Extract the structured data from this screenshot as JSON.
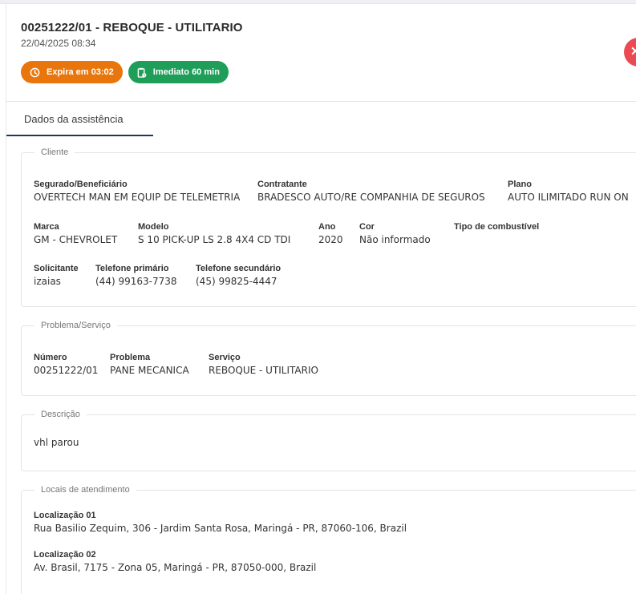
{
  "header": {
    "title": "00251222/01 - REBOQUE - UTILITARIO",
    "datetime": "22/04/2025 08:34",
    "badge_expira": "Expira em 03:02",
    "badge_imediato": "Imediato 60 min",
    "expira_icon": "clock-icon",
    "imediato_icon": "clipboard-clock-icon",
    "close_icon": "close-icon"
  },
  "tabs": [
    {
      "label": "Dados da assistência"
    }
  ],
  "cliente": {
    "legend": "Cliente",
    "segurado_label": "Segurado/Beneficiário",
    "segurado_value": "OVERTECH MAN EM EQUIP DE TELEMETRIA",
    "contratante_label": "Contratante",
    "contratante_value": "BRADESCO AUTO/RE COMPANHIA DE SEGUROS",
    "plano_label": "Plano",
    "plano_value": "AUTO ILIMITADO RUN ON",
    "marca_label": "Marca",
    "marca_value": "GM - CHEVROLET",
    "modelo_label": "Modelo",
    "modelo_value": "S 10 PICK-UP LS 2.8 4X4 CD TDI",
    "ano_label": "Ano",
    "ano_value": "2020",
    "cor_label": "Cor",
    "cor_value": "Não informado",
    "combustivel_label": "Tipo de combustível",
    "combustivel_value": "",
    "solicitante_label": "Solicitante",
    "solicitante_value": "izaias",
    "tel1_label": "Telefone primário",
    "tel1_value": "(44) 99163-7738",
    "tel2_label": "Telefone secundário",
    "tel2_value": "(45) 99825-4447"
  },
  "problema": {
    "legend": "Problema/Serviço",
    "numero_label": "Número",
    "numero_value": "00251222/01",
    "problema_label": "Problema",
    "problema_value": "PANE MECANICA",
    "servico_label": "Serviço",
    "servico_value": "REBOQUE - UTILITARIO"
  },
  "descricao": {
    "legend": "Descrição",
    "text": "vhl parou"
  },
  "locais": {
    "legend": "Locais de atendimento",
    "loc1_label": "Localização 01",
    "loc1_value": "Rua Basilio Zequim, 306 - Jardim Santa Rosa, Maringá - PR, 87060-106, Brazil",
    "loc2_label": "Localização 02",
    "loc2_value": "Av. Brasil, 7175 - Zona 05, Maringá - PR, 87050-000, Brazil"
  },
  "colors": {
    "expira_badge": "#e8760c",
    "imediato_badge": "#1f9e5a",
    "close_button": "#ec4a52",
    "tab_underline": "#1f3a55"
  }
}
